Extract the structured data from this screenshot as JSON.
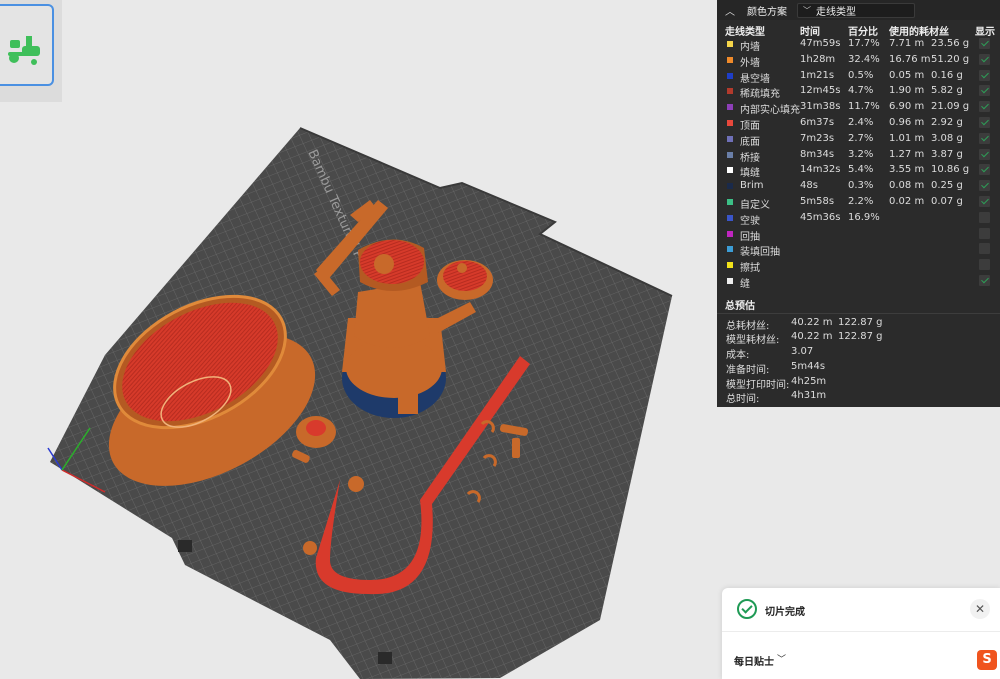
{
  "legend": {
    "title": "颜色方案",
    "view_mode": "走线类型",
    "columns": {
      "type": "走线类型",
      "time": "时间",
      "percent": "百分比",
      "filament": "使用的耗材丝",
      "show": "显示"
    },
    "rows": [
      {
        "label": "内墙",
        "color": "#f5d54a",
        "time": "47m59s",
        "percent": "17.7%",
        "length": "7.71 m",
        "weight": "23.56 g",
        "shown": true
      },
      {
        "label": "外墙",
        "color": "#f08a2a",
        "time": "1h28m",
        "percent": "32.4%",
        "length": "16.76 m",
        "weight": "51.20 g",
        "shown": true
      },
      {
        "label": "悬空墙",
        "color": "#1e3ec8",
        "time": "1m21s",
        "percent": "0.5%",
        "length": "0.05 m",
        "weight": "0.16 g",
        "shown": true
      },
      {
        "label": "稀疏填充",
        "color": "#b23a2c",
        "time": "12m45s",
        "percent": "4.7%",
        "length": "1.90 m",
        "weight": "5.82 g",
        "shown": true
      },
      {
        "label": "内部实心填充",
        "color": "#8e3fb8",
        "time": "31m38s",
        "percent": "11.7%",
        "length": "6.90 m",
        "weight": "21.09 g",
        "shown": true
      },
      {
        "label": "顶面",
        "color": "#e8483c",
        "time": "6m37s",
        "percent": "2.4%",
        "length": "0.96 m",
        "weight": "2.92 g",
        "shown": true
      },
      {
        "label": "底面",
        "color": "#6f70b8",
        "time": "7m23s",
        "percent": "2.7%",
        "length": "1.01 m",
        "weight": "3.08 g",
        "shown": true
      },
      {
        "label": "桥接",
        "color": "#6a7fa8",
        "time": "8m34s",
        "percent": "3.2%",
        "length": "1.27 m",
        "weight": "3.87 g",
        "shown": true
      },
      {
        "label": "填缝",
        "color": "#ffffff",
        "time": "14m32s",
        "percent": "5.4%",
        "length": "3.55 m",
        "weight": "10.86 g",
        "shown": true
      },
      {
        "label": "Brim",
        "color": "#1a2a4a",
        "time": "48s",
        "percent": "0.3%",
        "length": "0.08 m",
        "weight": "0.25 g",
        "shown": true
      },
      {
        "label": "自定义",
        "color": "#3cbf86",
        "time": "5m58s",
        "percent": "2.2%",
        "length": "0.02 m",
        "weight": "0.07 g",
        "shown": true
      },
      {
        "label": "空驶",
        "color": "#3a55c8",
        "time": "45m36s",
        "percent": "16.9%",
        "length": "",
        "weight": "",
        "shown": false
      },
      {
        "label": "回抽",
        "color": "#c025c0",
        "time": "",
        "percent": "",
        "length": "",
        "weight": "",
        "shown": false
      },
      {
        "label": "装填回抽",
        "color": "#3c9dd6",
        "time": "",
        "percent": "",
        "length": "",
        "weight": "",
        "shown": false
      },
      {
        "label": "擦拭",
        "color": "#f2e21a",
        "time": "",
        "percent": "",
        "length": "",
        "weight": "",
        "shown": false
      },
      {
        "label": "缝",
        "color": "#eeeeee",
        "time": "",
        "percent": "",
        "length": "",
        "weight": "",
        "shown": true
      }
    ]
  },
  "estimate": {
    "title": "总预估",
    "rows": [
      {
        "label": "总耗材丝:",
        "value": "40.22 m",
        "value2": "122.87 g"
      },
      {
        "label": "模型耗材丝:",
        "value": "40.22 m",
        "value2": "122.87 g"
      },
      {
        "label": "成本:",
        "value": "3.07",
        "value2": ""
      },
      {
        "label": "准备时间:",
        "value": "5m44s",
        "value2": ""
      },
      {
        "label": "模型打印时间:",
        "value": "4h25m",
        "value2": ""
      },
      {
        "label": "总时间:",
        "value": "4h31m",
        "value2": ""
      }
    ]
  },
  "plate": {
    "brand_text": "Bambu Textured P",
    "colors": {
      "plate": "#4a4a4a",
      "grid": "#6a6a6a",
      "wall": "#c8692a",
      "top": "#d83a2c",
      "brim": "#1e3a6a"
    }
  },
  "toast": {
    "message": "切片完成",
    "tip": "每日贴士"
  },
  "sogou_label": "S"
}
